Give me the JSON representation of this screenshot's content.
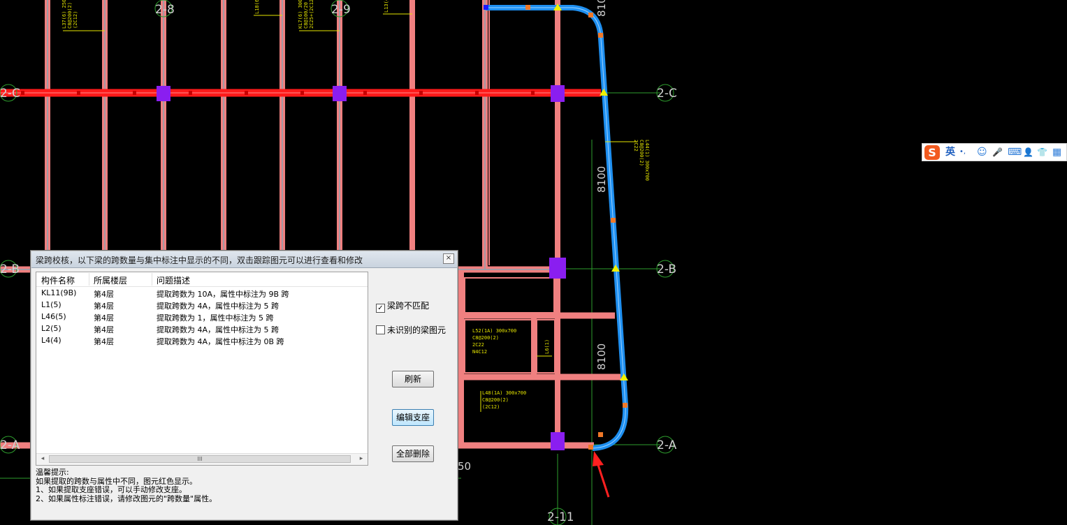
{
  "cad": {
    "axis_labels": {
      "a_2_8": "2-8",
      "a_2_9": "2-9",
      "a_2_11": "2-11",
      "a_2_c_left": "2-C",
      "a_2_c_right": "2-C",
      "a_2_b_left": "2-B",
      "a_2_b_right": "2-B",
      "a_2_a_left": "2-A",
      "a_2_a_right": "2-A"
    },
    "dims": {
      "d_top": "810",
      "d_mid": "8100",
      "d_low": "8100",
      "d_bottom": "50"
    },
    "annotations": {
      "l37": [
        "L37(6) 250x",
        "C8@200(2)",
        "(2C12)"
      ],
      "l18": "L18(6",
      "kl7": [
        "KL7(6) 300x",
        "C8@100/20",
        "2C25+(2C12"
      ],
      "l13": "L13(4",
      "l44": [
        "L44(1) 300x700",
        "C8@200(2)",
        "2C22"
      ],
      "l52": [
        "L52(1A) 300x700",
        "C8@200(2)",
        "2C22",
        "N4C12"
      ],
      "l6": "L6(1)",
      "l48": [
        "L48(1A) 300x700",
        "C8@200(2)",
        "(2C12)"
      ]
    }
  },
  "dialog": {
    "title": "梁跨校核，以下梁的跨数量与集中标注中显示的不同，双击跟踪图元可以进行查看和修改",
    "close_label": "×",
    "columns": [
      "构件名称",
      "所属楼层",
      "问题描述"
    ],
    "rows": [
      {
        "name": "KL11(9B)",
        "floor": "第4层",
        "desc": "提取跨数为 10A，属性中标注为 9B 跨"
      },
      {
        "name": "L1(5)",
        "floor": "第4层",
        "desc": "提取跨数为 4A，属性中标注为 5 跨"
      },
      {
        "name": "L46(5)",
        "floor": "第4层",
        "desc": "提取跨数为 1，属性中标注为 5 跨"
      },
      {
        "name": "L2(5)",
        "floor": "第4层",
        "desc": "提取跨数为 4A，属性中标注为 5 跨"
      },
      {
        "name": "L4(4)",
        "floor": "第4层",
        "desc": "提取跨数为 4A，属性中标注为 0B 跨"
      }
    ],
    "scroll_left": "◂",
    "scroll_right": "▸",
    "scroll_grip": "III",
    "checkbox_mismatch": {
      "label": "梁跨不匹配",
      "checked": true,
      "mark": "✓"
    },
    "checkbox_unrecognized": {
      "label": "未识别的梁图元",
      "checked": false,
      "mark": ""
    },
    "refresh_label": "刷新",
    "edit_support_label": "编辑支座",
    "delete_all_label": "全部删除",
    "hint_title": "温馨提示:",
    "hint_lines": [
      "如果提取的跨数与属性中不同，图元红色显示。",
      "1、如果提取支座错误，可以手动修改支座。",
      "2、如果属性标注错误，请修改图元的\"跨数量\"属性。"
    ]
  },
  "ime": {
    "logo": "S",
    "lang": "英",
    "punct": "•,",
    "emoji": "☺",
    "mic": "🎤",
    "keyboard": "⌨",
    "user": "👤",
    "skin": "👕",
    "apps": "▦"
  }
}
